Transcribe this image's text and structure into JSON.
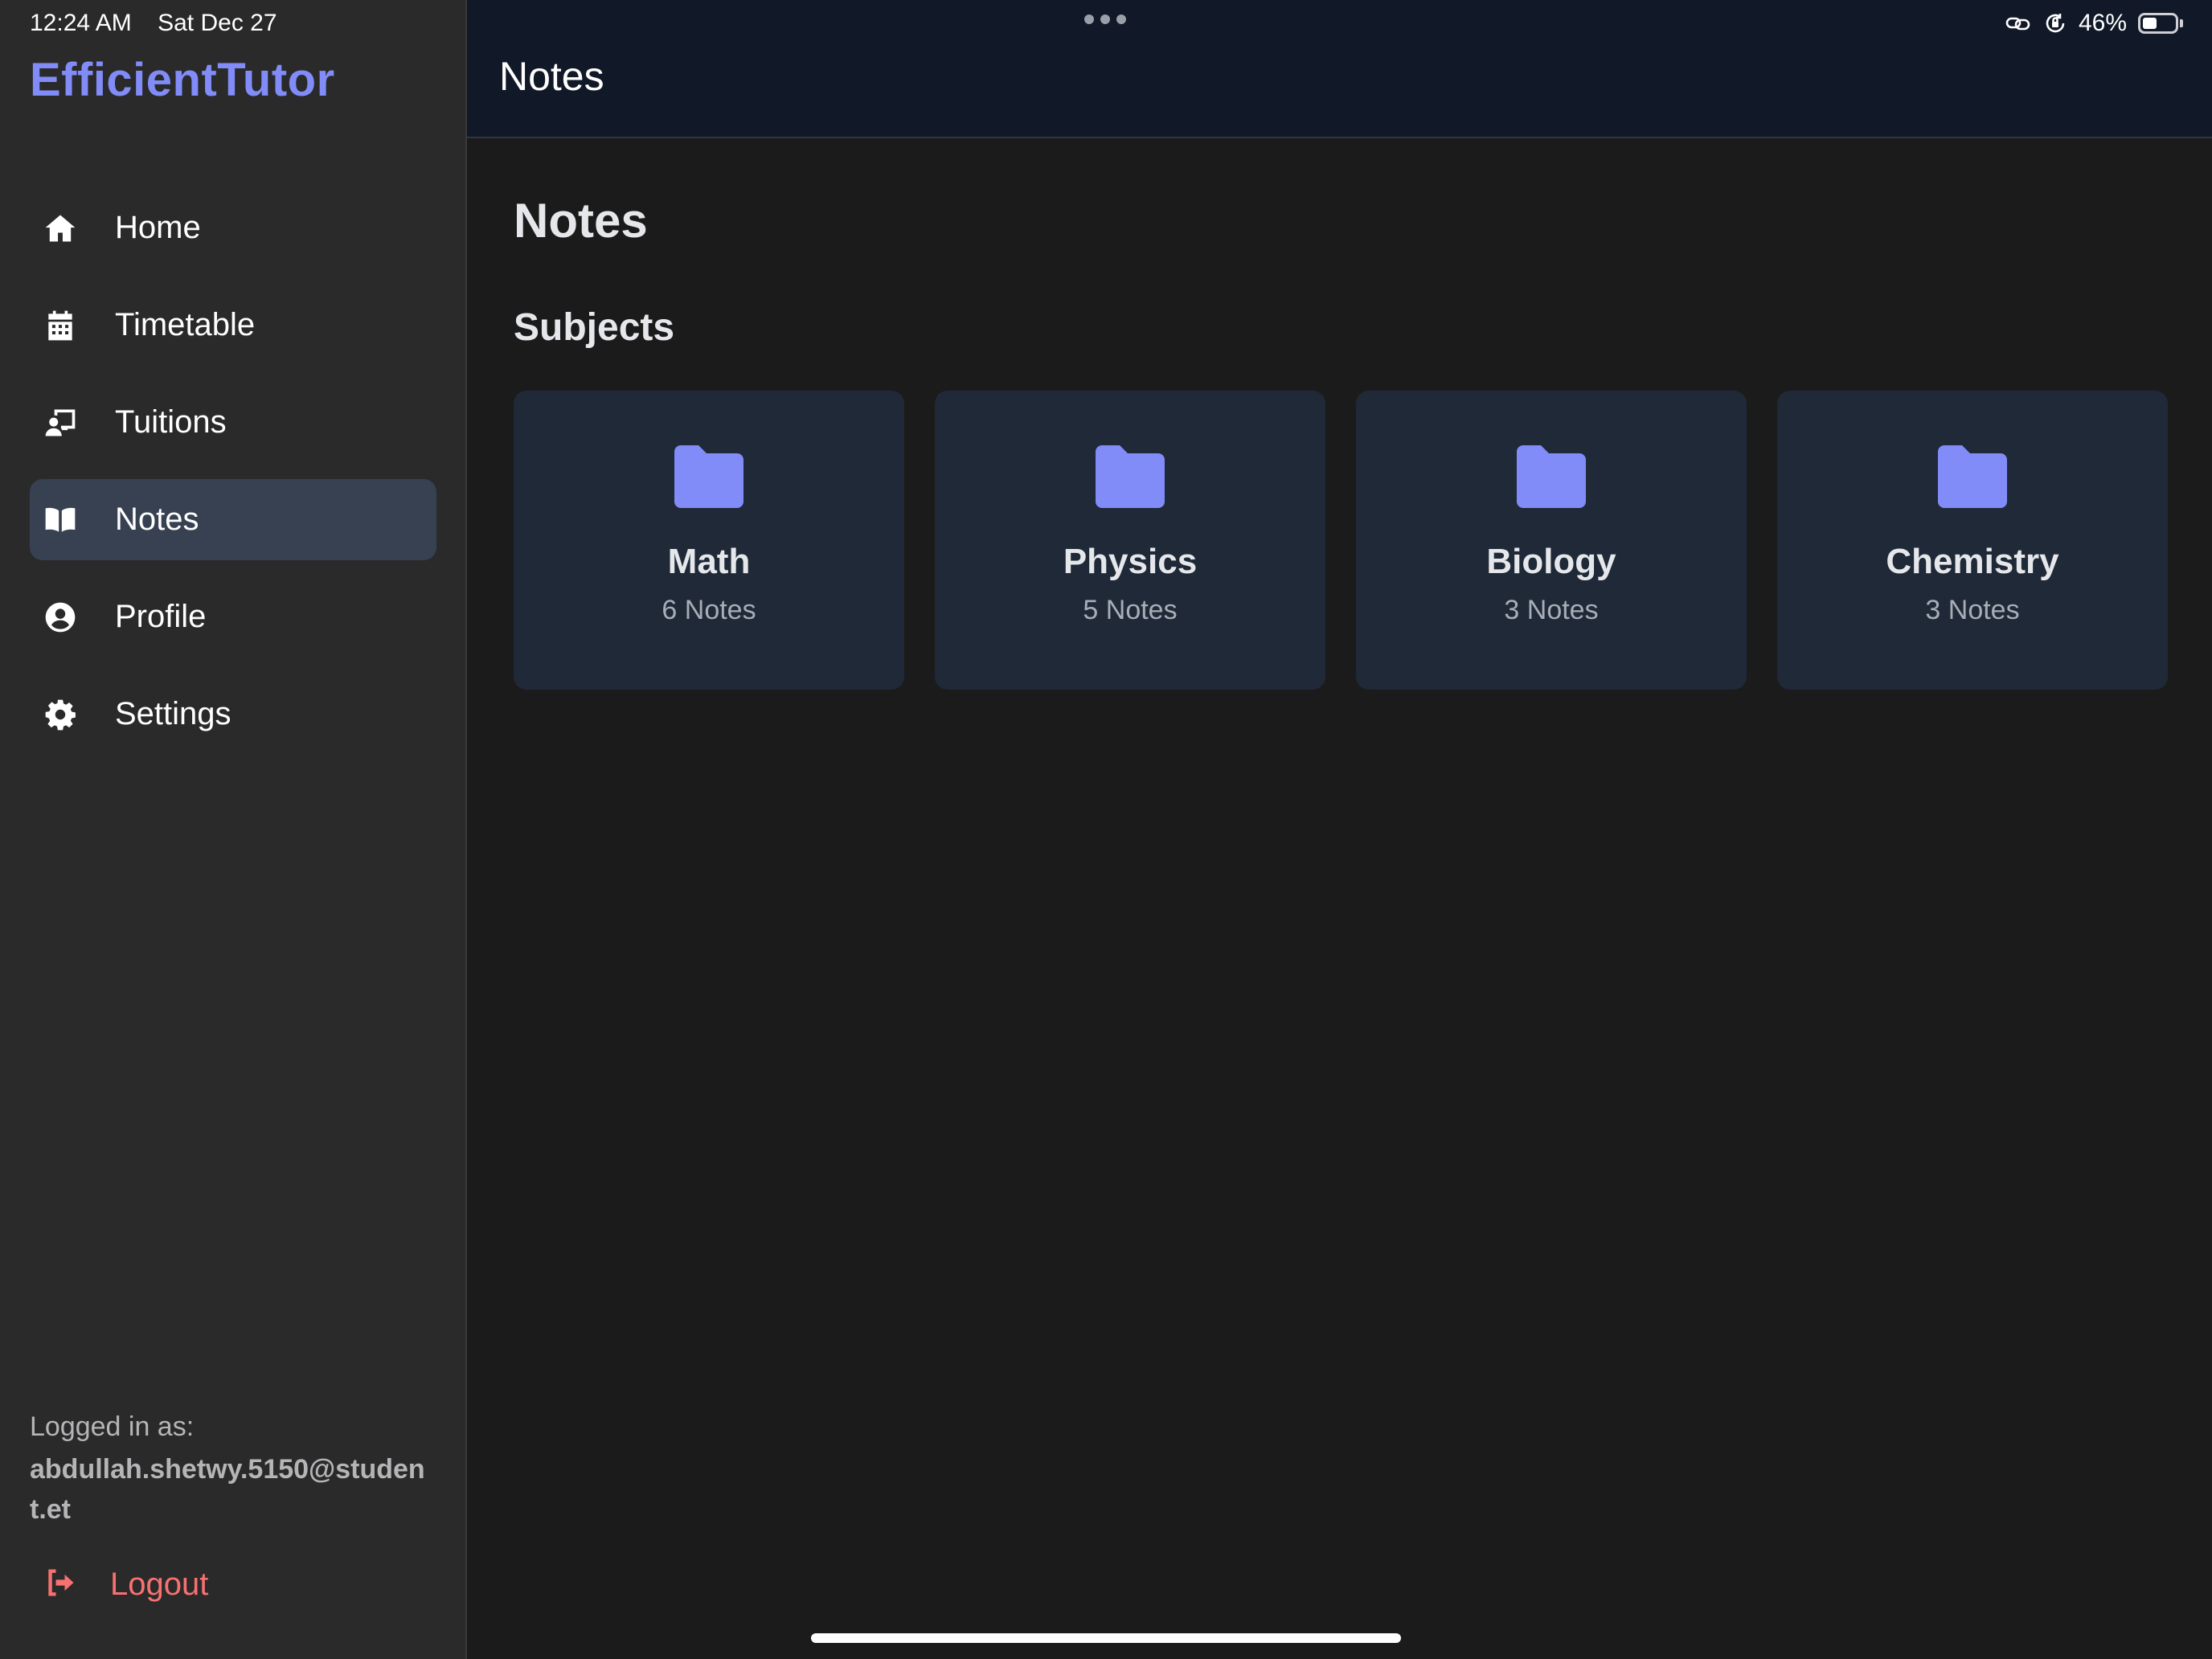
{
  "status_bar": {
    "time": "12:24 AM",
    "date": "Sat Dec 27",
    "battery_percent": "46%",
    "battery_level": 0.46
  },
  "colors": {
    "accent": "#818cf8",
    "sidebar_bg": "#2a2a2a",
    "active_bg": "#374151",
    "card_bg": "#1f2937",
    "topbar_bg": "#111827",
    "logout": "#f87171"
  },
  "sidebar": {
    "brand": "EfficientTutor",
    "items": [
      {
        "label": "Home",
        "icon": "home-icon"
      },
      {
        "label": "Timetable",
        "icon": "calendar-icon"
      },
      {
        "label": "Tuitions",
        "icon": "teacher-board-icon"
      },
      {
        "label": "Notes",
        "icon": "book-icon",
        "active": true
      },
      {
        "label": "Profile",
        "icon": "user-circle-icon"
      },
      {
        "label": "Settings",
        "icon": "gear-icon"
      }
    ],
    "logged_in_label": "Logged in as:",
    "logged_in_email": "abdullah.shetwy.5150@student.et",
    "logout_label": "Logout",
    "logout_icon": "logout-icon"
  },
  "topbar": {
    "title": "Notes"
  },
  "main": {
    "heading": "Notes",
    "section_heading": "Subjects",
    "subjects": [
      {
        "name": "Math",
        "count": "6 Notes",
        "icon": "folder-icon"
      },
      {
        "name": "Physics",
        "count": "5 Notes",
        "icon": "folder-icon"
      },
      {
        "name": "Biology",
        "count": "3 Notes",
        "icon": "folder-icon"
      },
      {
        "name": "Chemistry",
        "count": "3 Notes",
        "icon": "folder-icon"
      }
    ]
  }
}
